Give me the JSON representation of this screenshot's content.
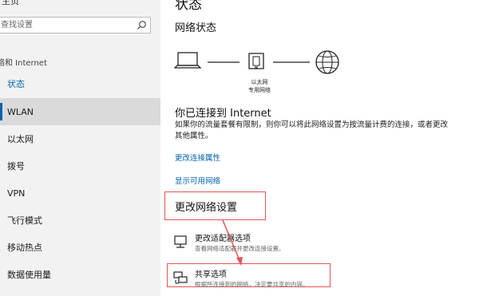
{
  "sidebar": {
    "home_partial": "主页",
    "search_placeholder": "查找设置",
    "section_label": "络和 Internet",
    "items": [
      {
        "label": "状态"
      },
      {
        "label": "WLAN"
      },
      {
        "label": "以太网"
      },
      {
        "label": "拨号"
      },
      {
        "label": "VPN"
      },
      {
        "label": "飞行模式"
      },
      {
        "label": "移动热点"
      },
      {
        "label": "数据使用量"
      }
    ]
  },
  "main": {
    "title_partial": "状态",
    "network_status_heading": "网络状态",
    "ethernet_label_line1": "以太网",
    "ethernet_label_line2": "专用网络",
    "connected_heading": "你已连接到 Internet",
    "description": "如果你的流量套餐有限制，则你可以将此网络设置为按流量计费的连接，或者更改其他属性。",
    "link_change_properties": "更改连接属性",
    "link_show_networks": "显示可用网络",
    "change_settings_heading": "更改网络设置",
    "adapter_option": {
      "title": "更改适配器选项",
      "desc": "查看网络适配器并更改连接设置。"
    },
    "sharing_option": {
      "title": "共享选项",
      "desc": "根据所连接到的网络，决定要共享的内容。"
    }
  },
  "annotation_color": "#e05555",
  "accent_color": "#0063b1"
}
